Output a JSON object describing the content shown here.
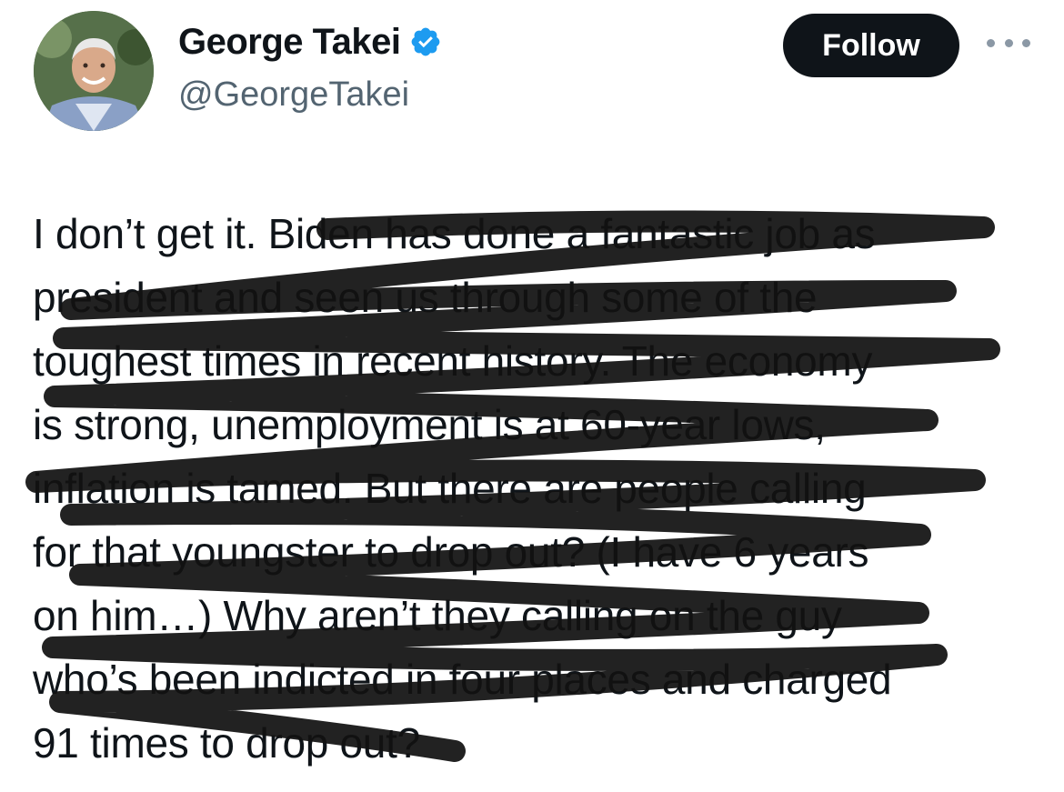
{
  "author": {
    "display_name": "George Takei",
    "handle": "@GeorgeTakei",
    "verified": true,
    "verified_color": "#1d9bf0",
    "avatar_icon": "profile-photo"
  },
  "actions": {
    "follow_label": "Follow",
    "more_icon": "ellipsis-icon"
  },
  "tweet": {
    "lines": [
      "I don’t get it. Biden has done a fantastic job as",
      "president and seen us through some of the",
      "toughest times in recent history. The economy",
      "is strong, unemployment is at 60-year lows,",
      "inflation is tamed. But there are people calling",
      "for that youngster to drop out? (I have 6 years",
      "on him…) Why aren’t they calling on the guy",
      "who’s been indicted in four places and charged",
      "91 times to drop out?"
    ]
  },
  "overlay": {
    "scribble_color": "#111111"
  }
}
